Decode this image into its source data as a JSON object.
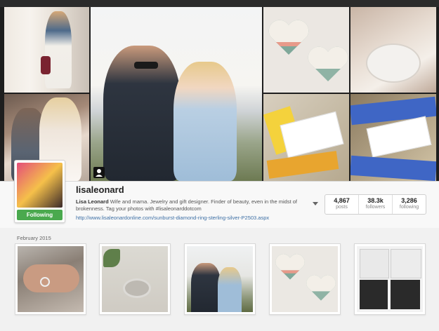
{
  "profile": {
    "username": "lisaleonard",
    "bio_name": "Lisa Leonard",
    "bio_text": " Wife and mama. Jewelry and gift designer. Finder of beauty, even in the midst of brokenness. Tag your photos with #lisaleonarddotcom",
    "website": "http://www.lisaleonardonline.com/sunburst-diamond-ring-sterling-silver-P2503.aspx",
    "follow_button": "Following"
  },
  "stats": [
    {
      "value": "4,867",
      "label": "posts"
    },
    {
      "value": "38.3k",
      "label": "followers"
    },
    {
      "value": "3,286",
      "label": "following"
    }
  ],
  "feed": {
    "month_label": "February 2015"
  },
  "icons": {
    "menu": "chevron-down-icon",
    "photo_of_you": "person-tag-icon"
  },
  "colors": {
    "follow_green": "#4aa94e",
    "link_blue": "#3d6fa5"
  }
}
